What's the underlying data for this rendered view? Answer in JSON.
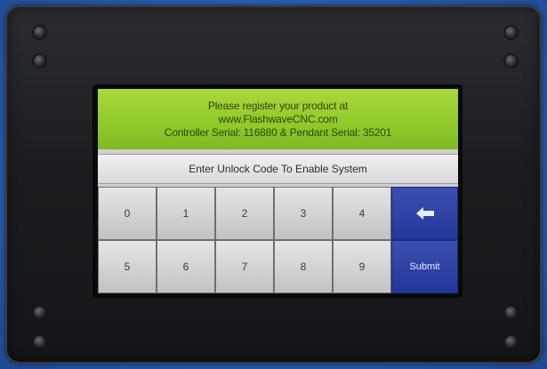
{
  "registration": {
    "line1": "Please register your product at",
    "line2": "www.FlashwaveCNC.com",
    "line3": "Controller Serial: 116880 & Pendant Serial: 35201"
  },
  "unlock_prompt": "Enter Unlock Code To Enable System",
  "keypad": {
    "keys_row1": [
      "0",
      "1",
      "2",
      "3",
      "4"
    ],
    "keys_row2": [
      "5",
      "6",
      "7",
      "8",
      "9"
    ],
    "backspace_icon": "backspace-arrow-icon",
    "submit_label": "Submit"
  },
  "colors": {
    "banner": "#8fc92a",
    "action_keys": "#2a3ea2",
    "background": "#2a5fae"
  }
}
